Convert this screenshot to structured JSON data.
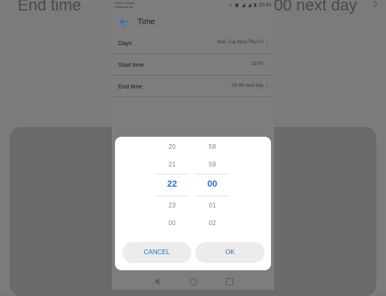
{
  "background": {
    "title": "End time",
    "value": "00 next day"
  },
  "status_bar": {
    "carrier_line1": "EDIC Hourse",
    "carrier_line2": "Vodafone IN",
    "time": "20:40"
  },
  "app_bar": {
    "title": "Time"
  },
  "settings": {
    "rows": [
      {
        "label": "Days",
        "value": "Mon Tue Wed Thu Fri"
      },
      {
        "label": "Start time",
        "value": "22:00"
      },
      {
        "label": "End time",
        "value": "06:00 next day"
      }
    ]
  },
  "picker": {
    "hours": [
      "20",
      "21",
      "22",
      "23",
      "00"
    ],
    "minutes": [
      "58",
      "59",
      "00",
      "01",
      "02"
    ],
    "selected_index": 2,
    "accent_color": "#1a73e8"
  },
  "dialog": {
    "cancel_label": "CANCEL",
    "ok_label": "OK"
  }
}
